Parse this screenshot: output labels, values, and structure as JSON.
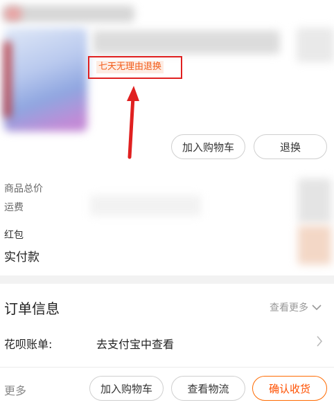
{
  "product": {
    "return_tag": "七天无理由退换"
  },
  "actions": {
    "add_to_cart": "加入购物车",
    "return_exchange": "退换"
  },
  "cost": {
    "goods_total_label": "商品总价",
    "shipping_label": "运费",
    "red_packet_label": "红包",
    "actual_paid_label": "实付款"
  },
  "order_info": {
    "title": "订单信息",
    "see_more": "查看更多",
    "huabei_label": "花呗账单:",
    "huabei_value": "去支付宝中查看"
  },
  "bottom_bar": {
    "more": "更多",
    "add_to_cart": "加入购物车",
    "view_logistics": "查看物流",
    "confirm_receipt": "确认收货"
  },
  "colors": {
    "accent": "#ff5000",
    "annotation": "#e02020"
  }
}
